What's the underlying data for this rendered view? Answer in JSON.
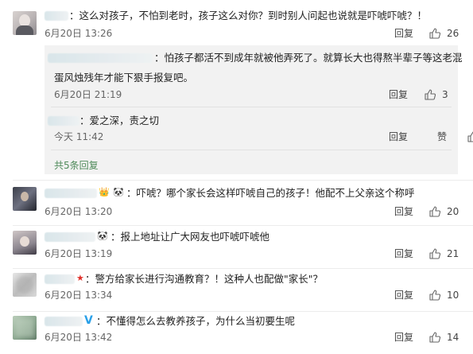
{
  "icons": {
    "like": "thumb-up-icon",
    "v_badge": "verified-v-icon",
    "panda": "panda-emoji-icon",
    "star": "red-star-icon",
    "crown": "crown-icon"
  },
  "colors": {
    "link_green": "#4f8b5a",
    "text": "#222222",
    "meta": "#666666",
    "reply_bg": "#f2f2f2",
    "v_blue": "#2aa0e8"
  },
  "comments": [
    {
      "text": "：这么对孩子，不怕到老时，孩子这么对你？到时别人问起也说就是吓唬吓唬？！",
      "time": "6月20日 13:26",
      "reply": "回复",
      "likes": "26"
    },
    {
      "text": "：吓唬？哪个家长会这样吓唬自己的孩子！他配不上父亲这个称呼",
      "time": "6月20日 13:20",
      "reply": "回复",
      "likes": "20"
    },
    {
      "text": "：报上地址让广大网友也吓唬吓唬他",
      "time": "6月20日 13:19",
      "reply": "回复",
      "likes": "21"
    },
    {
      "text": "：警方给家长进行沟通教育？！这种人也配做\"家长\"？",
      "time": "6月20日 13:34",
      "reply": "回复",
      "likes": "10"
    },
    {
      "text": "：不懂得怎么去教养孩子，为什么当初要生呢",
      "time": "6月20日 13:42",
      "reply": "回复",
      "likes": "14"
    }
  ],
  "replies": [
    {
      "line1": "：怕孩子都活不到成年就被他弄死了。就算长大也得熬半辈子等这老混",
      "line2": "蛋风烛残年才能下狠手报复吧。",
      "time": "6月20日 21:19",
      "reply": "回复",
      "likes": "3"
    },
    {
      "text": "：爱之深，责之切",
      "time": "今天 11:42",
      "reply": "回复",
      "likes": "赞"
    }
  ],
  "more_replies": "共5条回复"
}
